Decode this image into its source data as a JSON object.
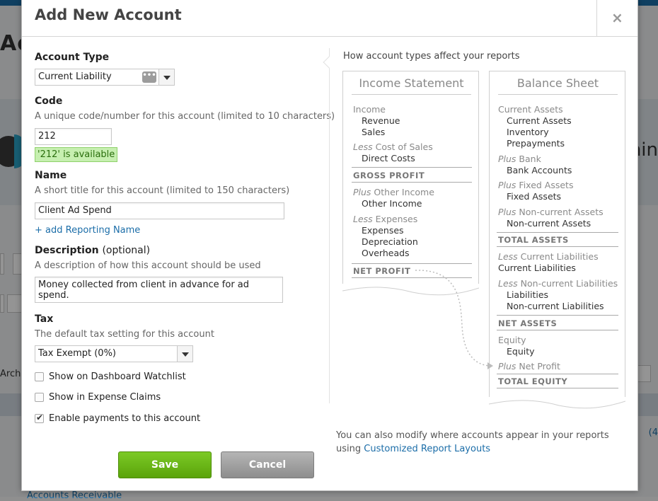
{
  "background": {
    "title_partial": "Ac",
    "right_text_partial": "nin",
    "archive_partial": "Archi",
    "right_number_partial": "(4",
    "bottom_link_partial": "Accounts Receivable"
  },
  "modal": {
    "title": "Add New Account",
    "close_label": "×",
    "account_type": {
      "label": "Account Type",
      "value": "Current Liability"
    },
    "code": {
      "label": "Code",
      "hint": "A unique code/number for this account (limited to 10 characters)",
      "value": "212",
      "availability": "'212' is available"
    },
    "name": {
      "label": "Name",
      "hint": "A short title for this account (limited to 150 characters)",
      "value": "Client Ad Spend",
      "add_reporting_link": "+ add Reporting Name"
    },
    "description": {
      "label": "Description",
      "optional": "(optional)",
      "hint": "A description of how this account should be used",
      "value": "Money collected from client in advance for ad spend."
    },
    "tax": {
      "label": "Tax",
      "hint": "The default tax setting for this account",
      "value": "Tax Exempt (0%)"
    },
    "checkboxes": [
      {
        "label": "Show on Dashboard Watchlist",
        "checked": false
      },
      {
        "label": "Show in Expense Claims",
        "checked": false
      },
      {
        "label": "Enable payments to this account",
        "checked": true
      }
    ],
    "save_label": "Save",
    "cancel_label": "Cancel"
  },
  "panel": {
    "title": "How account types affect your reports",
    "income_statement": {
      "heading": "Income Statement",
      "income": "Income",
      "revenue": "Revenue",
      "sales": "Sales",
      "less1": "Less",
      "cost_of_sales": " Cost of Sales",
      "direct_costs": "Direct Costs",
      "gross_profit": "GROSS PROFIT",
      "plus1": "Plus",
      "other_income_group": " Other Income",
      "other_income": "Other Income",
      "less2": "Less",
      "expenses_group": " Expenses",
      "expenses": "Expenses",
      "depreciation": "Depreciation",
      "overheads": "Overheads",
      "net_profit": "NET PROFIT"
    },
    "balance_sheet": {
      "heading": "Balance Sheet",
      "current_assets_group": "Current Assets",
      "current_assets": "Current Assets",
      "inventory": "Inventory",
      "prepayments": "Prepayments",
      "plus1": "Plus",
      "bank_group": " Bank",
      "bank_accounts": "Bank Accounts",
      "plus2": "Plus",
      "fixed_assets_group": " Fixed Assets",
      "fixed_assets": "Fixed Assets",
      "plus3": "Plus",
      "noncurrent_assets_group": " Non-current Assets",
      "noncurrent_assets": "Non-current Assets",
      "total_assets": "TOTAL ASSETS",
      "less1": "Less",
      "current_liabilities_group": " Current Liabilities",
      "current_liabilities": "Current Liabilities",
      "less2": "Less",
      "noncurrent_liabilities_group": " Non-current Liabilities",
      "liabilities": "Liabilities",
      "noncurrent_liabilities": "Non-current Liabilities",
      "net_assets": "NET ASSETS",
      "equity_group": "Equity",
      "equity": "Equity",
      "plus4": "Plus",
      "net_profit": " Net Profit",
      "total_equity": "TOTAL EQUITY"
    },
    "footnote_text": "You can also modify where accounts appear in your reports using ",
    "footnote_link": "Customized Report Layouts"
  }
}
